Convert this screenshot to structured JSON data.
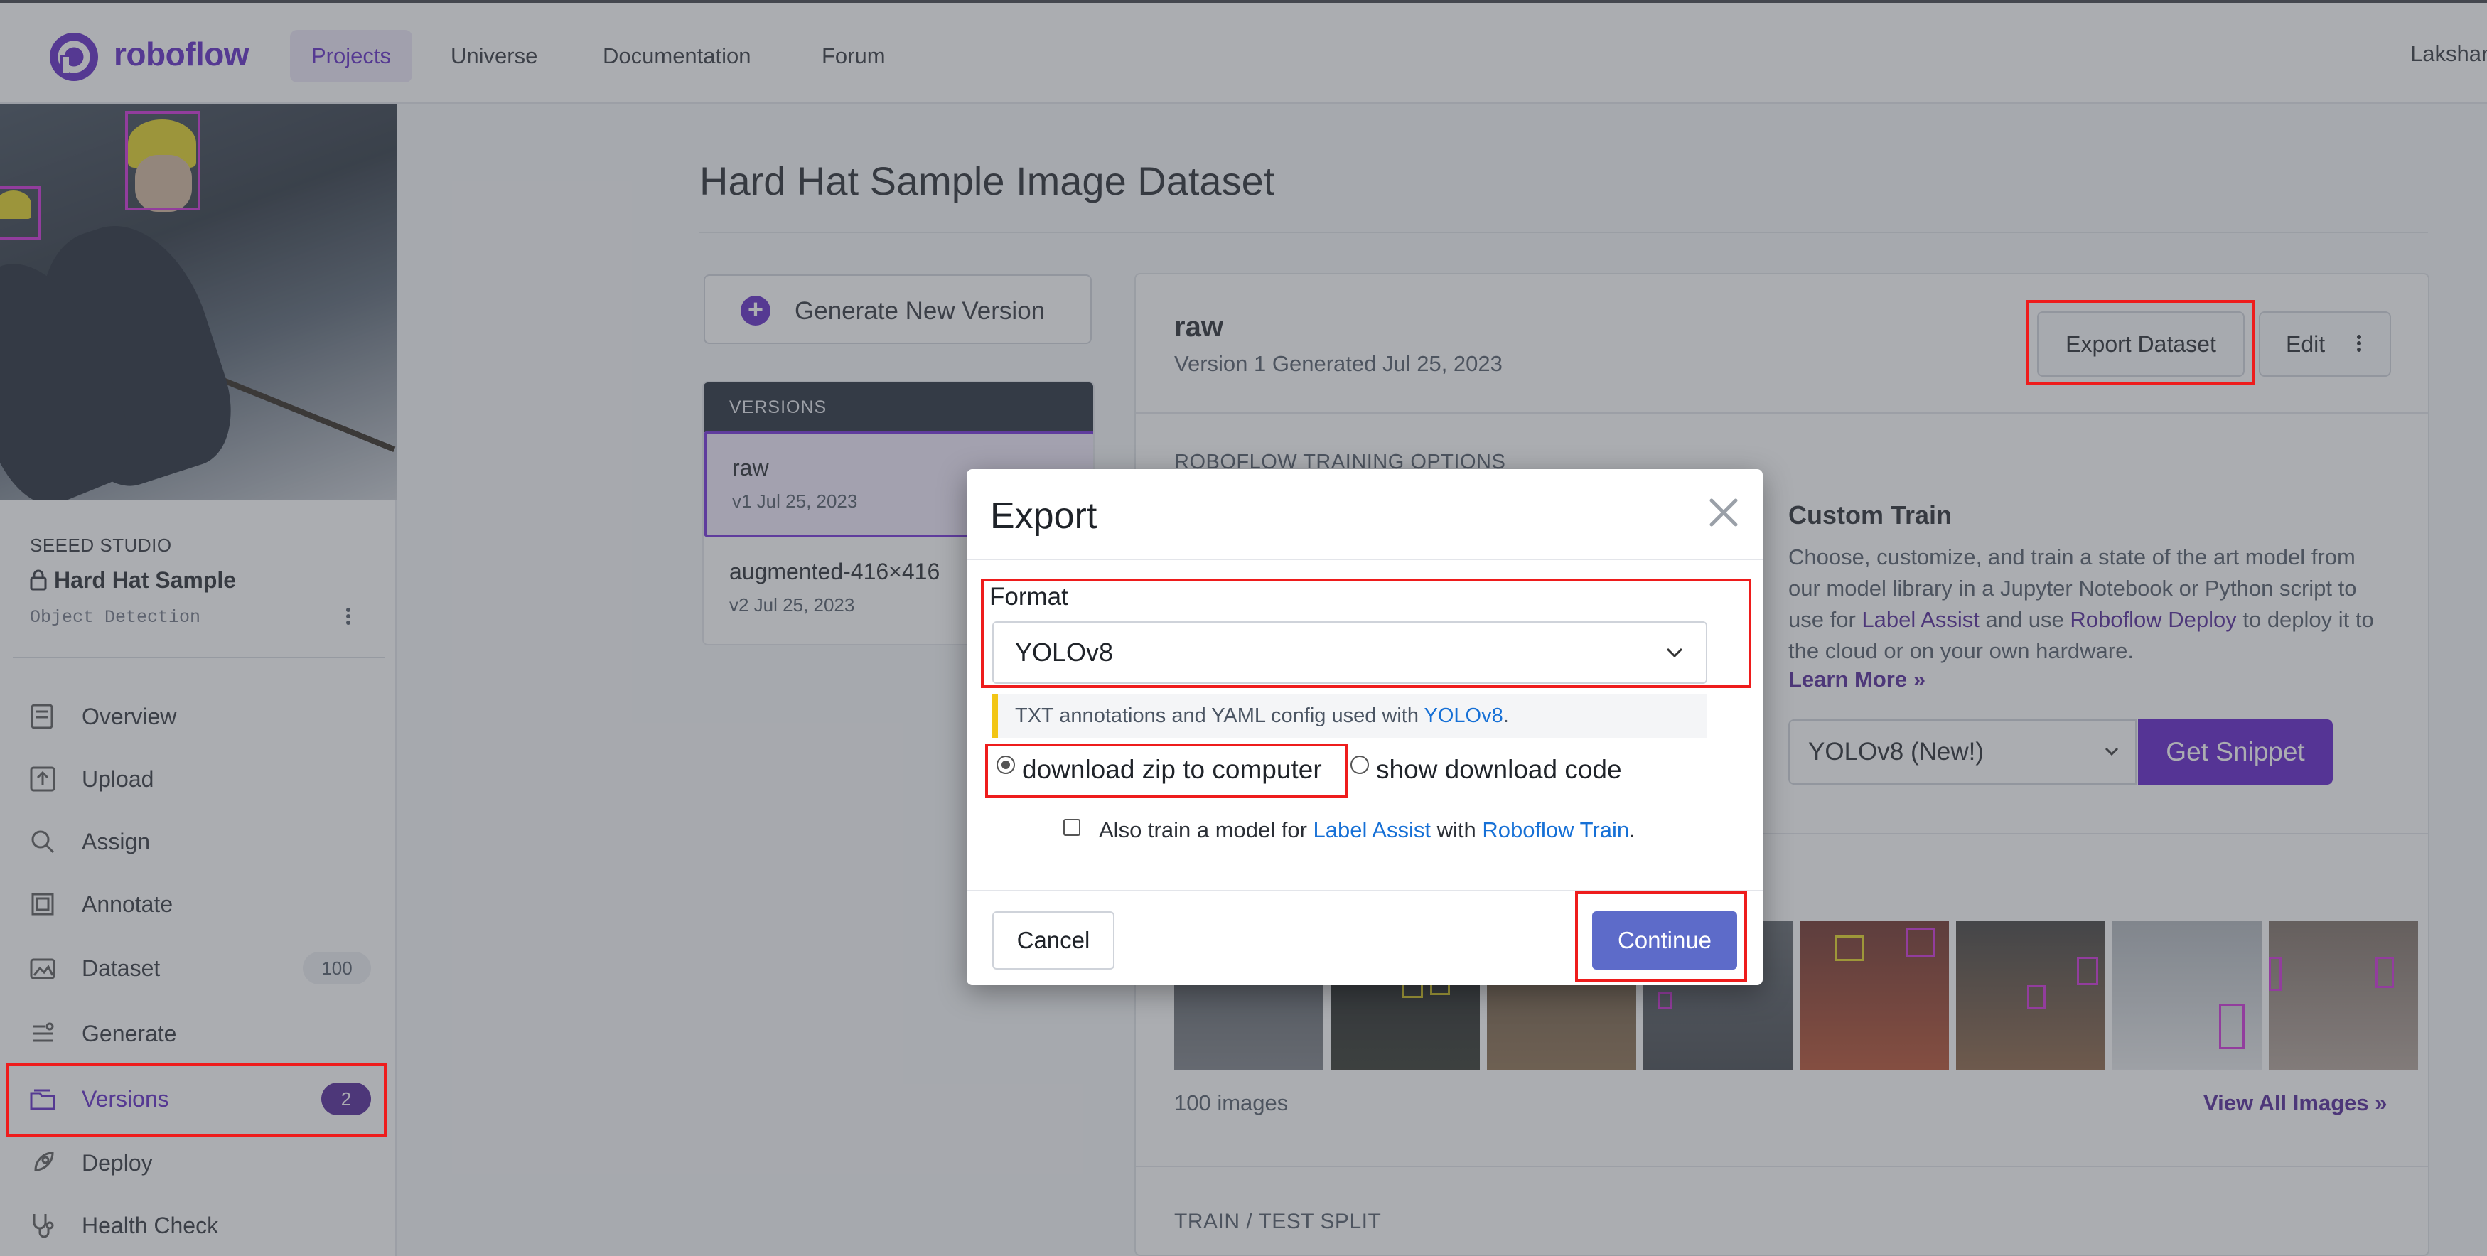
{
  "nav": {
    "brand": "roboflow",
    "items": [
      "Projects",
      "Universe",
      "Documentation",
      "Forum"
    ],
    "active_index": 0,
    "user": "Lakshan"
  },
  "sidebar": {
    "workspace": "SEEED STUDIO",
    "project_name": "Hard Hat Sample",
    "project_type": "Object Detection",
    "items": [
      {
        "label": "Overview",
        "icon": "overview-icon",
        "badge": ""
      },
      {
        "label": "Upload",
        "icon": "upload-icon",
        "badge": ""
      },
      {
        "label": "Assign",
        "icon": "search-icon",
        "badge": ""
      },
      {
        "label": "Annotate",
        "icon": "annotate-icon",
        "badge": ""
      },
      {
        "label": "Dataset",
        "icon": "dataset-icon",
        "badge": "100"
      },
      {
        "label": "Generate",
        "icon": "generate-icon",
        "badge": ""
      },
      {
        "label": "Versions",
        "icon": "versions-icon",
        "badge": "2"
      },
      {
        "label": "Deploy",
        "icon": "rocket-icon",
        "badge": ""
      },
      {
        "label": "Health Check",
        "icon": "stethoscope-icon",
        "badge": ""
      }
    ],
    "active_label": "Versions"
  },
  "main": {
    "title": "Hard Hat Sample Image Dataset",
    "generate_button": "Generate New Version",
    "versions_header": "VERSIONS",
    "versions": [
      {
        "name": "raw",
        "date": "v1 Jul 25, 2023",
        "selected": true
      },
      {
        "name": "augmented-416×416",
        "date": "v2 Jul 25, 2023",
        "selected": false
      }
    ],
    "card": {
      "version_name": "raw",
      "version_sub": "Version 1 Generated Jul 25, 2023",
      "export_button": "Export Dataset",
      "edit_button": "Edit",
      "training_options": "ROBOFLOW TRAINING OPTIONS",
      "custom_train_title": "Custom Train",
      "custom_train_desc_1": "Choose, customize, and train a state of the art model from our model library in a Jupyter Notebook or Python script to use for ",
      "custom_train_link_1": "Label Assist",
      "custom_train_desc_2": " and use ",
      "custom_train_link_2": "Roboflow Deploy",
      "custom_train_desc_3": " to deploy it to the cloud or on your own hardware.",
      "learn_more": "Learn More »",
      "model_select": "YOLOv8 (New!)",
      "snippet_button": "Get Snippet",
      "image_count": "100 images",
      "view_all": "View All Images »",
      "split_label": "TRAIN / TEST SPLIT"
    }
  },
  "modal": {
    "title": "Export",
    "format_label": "Format",
    "format_value": "YOLOv8",
    "hint_prefix": "TXT annotations and YAML config used with ",
    "hint_link": "YOLOv8",
    "hint_suffix": ".",
    "radio_download": "download zip to computer",
    "radio_code": "show download code",
    "radio_selected": "download zip to computer",
    "checkbox_prefix": "Also train a model for ",
    "checkbox_link_1": "Label Assist",
    "checkbox_mid": " with ",
    "checkbox_link_2": "Roboflow Train",
    "checkbox_suffix": ".",
    "checkbox_checked": false,
    "cancel": "Cancel",
    "continue": "Continue"
  },
  "colors": {
    "brand": "#5b21c4",
    "annotation_red": "#ee1c1c",
    "continue_button": "#5d6bc9",
    "link_blue": "#1670d6"
  }
}
